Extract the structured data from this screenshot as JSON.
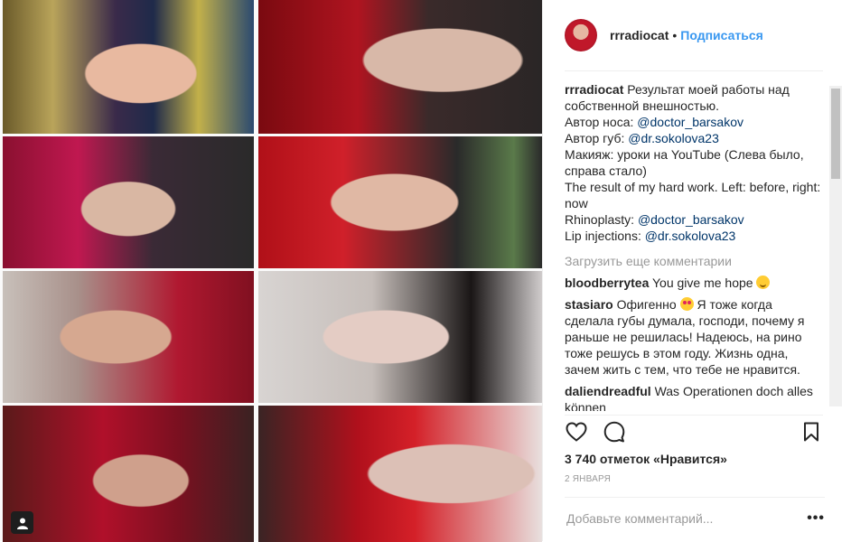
{
  "post": {
    "username": "rrradiocat",
    "separator": "•",
    "follow_label": "Подписаться"
  },
  "caption": {
    "username": "rrradiocat",
    "line1": "Результат моей работы над собственной внешностью.",
    "nose_label": "Автор носа:",
    "nose_link": "@doctor_barsakov",
    "lips_label": "Автор губ:",
    "lips_link": "@dr.sokolova23",
    "makeup": "Макияж: уроки на YouTube (Слева было, справа стало)",
    "english": "The result of my hard work. Left: before, right: now",
    "rhinoplasty_label": "Rhinoplasty:",
    "rhinoplasty_link": "@doctor_barsakov",
    "lip_inj_label": "Lip injections:",
    "lip_inj_link": "@dr.sokolova23"
  },
  "load_more": "Загрузить еще комментарии",
  "comments": [
    {
      "user": "bloodberrytea",
      "text": "You give me hope",
      "emoji": "smile-emoji"
    },
    {
      "user": "stasiaro",
      "text_before": "Офигенно",
      "emoji": "heart-eyes-emoji",
      "text_after": "Я тоже когда сделала губы думала, господи, почему я раньше не решилась! Надеюсь, на рино тоже решусь в этом году. Жизнь одна, зачем жить с тем, что тебе не нравится."
    },
    {
      "user": "daliendreadful",
      "text": "Was Operationen doch alles können"
    }
  ],
  "actions": {
    "like_icon": "heart-icon",
    "comment_icon": "comment-icon",
    "save_icon": "bookmark-icon"
  },
  "likes": "3 740 отметок «Нравится»",
  "date": "2 ЯНВАРЯ",
  "add_comment_placeholder": "Добавьте комментарий...",
  "more_label": "•••"
}
